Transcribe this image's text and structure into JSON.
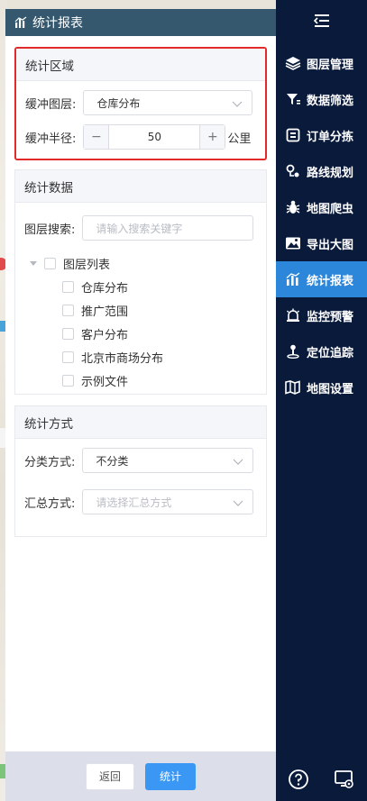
{
  "panel": {
    "title": "统计报表",
    "area": {
      "title": "统计区域",
      "layer_label": "缓冲图层:",
      "layer_value": "仓库分布",
      "radius_label": "缓冲半径:",
      "radius_value": "50",
      "radius_minus": "−",
      "radius_plus": "+",
      "radius_unit": "公里"
    },
    "data": {
      "title": "统计数据",
      "search_label": "图层搜索:",
      "search_placeholder": "请输入搜索关键字",
      "tree_root": "图层列表",
      "tree_items": [
        "仓库分布",
        "推广范围",
        "客户分布",
        "北京市商场分布",
        "示例文件"
      ]
    },
    "method": {
      "title": "统计方式",
      "class_label": "分类方式:",
      "class_value": "不分类",
      "summary_label": "汇总方式:",
      "summary_placeholder": "请选择汇总方式"
    },
    "footer": {
      "back_label": "返回",
      "stat_label": "统计"
    }
  },
  "sidebar": {
    "items": [
      {
        "label": "图层管理",
        "icon": "layers-icon"
      },
      {
        "label": "数据筛选",
        "icon": "filter-icon"
      },
      {
        "label": "订单分拣",
        "icon": "order-sort-icon"
      },
      {
        "label": "路线规划",
        "icon": "route-icon"
      },
      {
        "label": "地图爬虫",
        "icon": "bug-icon"
      },
      {
        "label": "导出大图",
        "icon": "image-export-icon"
      },
      {
        "label": "统计报表",
        "icon": "chart-icon",
        "active": true
      },
      {
        "label": "监控预警",
        "icon": "alarm-icon"
      },
      {
        "label": "定位追踪",
        "icon": "locate-icon"
      },
      {
        "label": "地图设置",
        "icon": "map-settings-icon"
      }
    ]
  },
  "colors": {
    "header_bg": "#35586f",
    "sidebar_bg": "#0a1a3b",
    "sidebar_active": "#2c86d9",
    "primary_button": "#3a97f3",
    "highlight_border": "#e32a2a"
  }
}
